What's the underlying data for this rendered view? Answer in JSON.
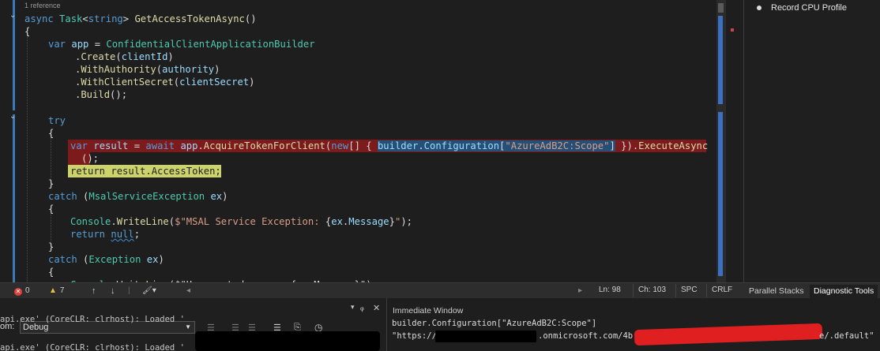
{
  "editor": {
    "reference_label": "1 reference",
    "lines": [
      [
        {
          "c": "kw",
          "t": "async "
        },
        {
          "c": "ty",
          "t": "Task"
        },
        {
          "c": "pn",
          "t": "<"
        },
        {
          "c": "kw",
          "t": "string"
        },
        {
          "c": "pn",
          "t": "> "
        },
        {
          "c": "md",
          "t": "GetAccessTokenAsync"
        },
        {
          "c": "pn",
          "t": "()"
        }
      ],
      [
        {
          "c": "pn",
          "t": "{"
        }
      ],
      [
        {
          "c": "kw",
          "t": "var "
        },
        {
          "c": "id",
          "t": "app"
        },
        {
          "c": "pn",
          "t": " = "
        },
        {
          "c": "ty",
          "t": "ConfidentialClientApplicationBuilder"
        }
      ],
      [
        {
          "c": "pn",
          "t": "."
        },
        {
          "c": "md",
          "t": "Create"
        },
        {
          "c": "pn",
          "t": "("
        },
        {
          "c": "id",
          "t": "clientId"
        },
        {
          "c": "pn",
          "t": ")"
        }
      ],
      [
        {
          "c": "pn",
          "t": "."
        },
        {
          "c": "md",
          "t": "WithAuthority"
        },
        {
          "c": "pn",
          "t": "("
        },
        {
          "c": "id",
          "t": "authority"
        },
        {
          "c": "pn",
          "t": ")"
        }
      ],
      [
        {
          "c": "pn",
          "t": "."
        },
        {
          "c": "md",
          "t": "WithClientSecret"
        },
        {
          "c": "pn",
          "t": "("
        },
        {
          "c": "id",
          "t": "clientSecret"
        },
        {
          "c": "pn",
          "t": ")"
        }
      ],
      [
        {
          "c": "pn",
          "t": "."
        },
        {
          "c": "md",
          "t": "Build"
        },
        {
          "c": "pn",
          "t": "();"
        }
      ],
      [
        {
          "c": "pn",
          "t": ""
        }
      ],
      [
        {
          "c": "kw",
          "t": "try"
        }
      ],
      [
        {
          "c": "pn",
          "t": "{"
        }
      ],
      [
        {
          "c": "kw",
          "t": "var "
        },
        {
          "c": "id",
          "t": "result"
        },
        {
          "c": "pn",
          "t": " = "
        },
        {
          "c": "kw",
          "t": "await "
        },
        {
          "c": "id",
          "t": "app"
        },
        {
          "c": "pn",
          "t": "."
        },
        {
          "c": "md",
          "t": "AcquireTokenForClient"
        },
        {
          "c": "pn",
          "t": "("
        },
        {
          "c": "kw",
          "t": "new"
        },
        {
          "c": "pn",
          "t": "[] { "
        },
        {
          "c": "id sel",
          "t": "builder"
        },
        {
          "c": "pn sel",
          "t": "."
        },
        {
          "c": "id sel",
          "t": "Configuration"
        },
        {
          "c": "pn sel",
          "t": "["
        },
        {
          "c": "st sel",
          "t": "\"AzureAdB2C:Scope\""
        },
        {
          "c": "pn sel",
          "t": "]"
        },
        {
          "c": "pn",
          "t": " })."
        },
        {
          "c": "md",
          "t": "ExecuteAsync"
        }
      ],
      [
        {
          "c": "pn",
          "t": "();"
        }
      ],
      [
        {
          "c": "yeltext",
          "t": "return result.AccessToken;"
        }
      ],
      [
        {
          "c": "pn",
          "t": "}"
        }
      ],
      [
        {
          "c": "kw",
          "t": "catch "
        },
        {
          "c": "pn",
          "t": "("
        },
        {
          "c": "ty",
          "t": "MsalServiceException"
        },
        {
          "c": "pn",
          "t": " "
        },
        {
          "c": "id",
          "t": "ex"
        },
        {
          "c": "pn",
          "t": ")"
        }
      ],
      [
        {
          "c": "pn",
          "t": "{"
        }
      ],
      [
        {
          "c": "ty",
          "t": "Console"
        },
        {
          "c": "pn",
          "t": "."
        },
        {
          "c": "md",
          "t": "WriteLine"
        },
        {
          "c": "pn",
          "t": "("
        },
        {
          "c": "st",
          "t": "$\"MSAL Service Exception: "
        },
        {
          "c": "pn",
          "t": "{"
        },
        {
          "c": "id",
          "t": "ex"
        },
        {
          "c": "pn",
          "t": "."
        },
        {
          "c": "id",
          "t": "Message"
        },
        {
          "c": "pn",
          "t": "}"
        },
        {
          "c": "st",
          "t": "\""
        },
        {
          "c": "pn",
          "t": ");"
        }
      ],
      [
        {
          "c": "kw",
          "t": "return "
        },
        {
          "c": "kw squig",
          "t": "null"
        },
        {
          "c": "pn",
          "t": ";"
        }
      ],
      [
        {
          "c": "pn",
          "t": "}"
        }
      ],
      [
        {
          "c": "kw",
          "t": "catch "
        },
        {
          "c": "pn",
          "t": "("
        },
        {
          "c": "ty",
          "t": "Exception"
        },
        {
          "c": "pn",
          "t": " "
        },
        {
          "c": "id",
          "t": "ex"
        },
        {
          "c": "pn",
          "t": ")"
        }
      ],
      [
        {
          "c": "pn",
          "t": "{"
        }
      ],
      [
        {
          "c": "ty",
          "t": "Console"
        },
        {
          "c": "pn",
          "t": "."
        },
        {
          "c": "md",
          "t": "WriteLine"
        },
        {
          "c": "pn",
          "t": "($\"Unexpected error: {ex.Message}\");"
        }
      ]
    ]
  },
  "status_bar": {
    "errors": "0",
    "warnings": "7",
    "line": "Ln: 98",
    "column": "Ch: 103",
    "spacing": "SPC",
    "line_ending": "CRLF"
  },
  "diagnostics": {
    "record_cpu_label": "Record CPU Profile",
    "tabs": [
      "Parallel Stacks",
      "Diagnostic Tools"
    ]
  },
  "output": {
    "from_label": "om:",
    "source": "Debug",
    "lines": [
      "api.exe' (CoreCLR: clrhost): Loaded '",
      "api.exe' (CoreCLR: clrhost): Loaded '"
    ]
  },
  "immediate": {
    "title": "Immediate Window",
    "expression": "builder.Configuration[\"AzureAdB2C:Scope\"]",
    "result_prefix": "\"https://",
    "result_middle": ".onmicrosoft.com/4b",
    "result_suffix": "e/.default\""
  }
}
